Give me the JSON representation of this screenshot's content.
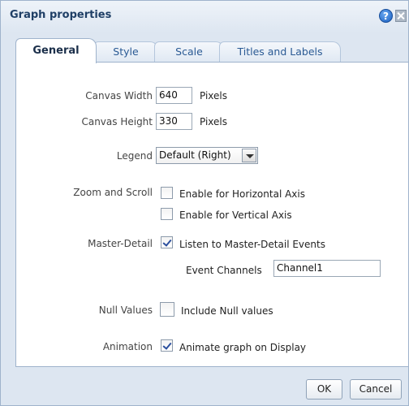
{
  "dialog": {
    "title": "Graph properties"
  },
  "tabs": [
    {
      "label": "General"
    },
    {
      "label": "Style"
    },
    {
      "label": "Scale"
    },
    {
      "label": "Titles and Labels"
    }
  ],
  "general": {
    "canvas_width_label": "Canvas Width",
    "canvas_width_value": "640",
    "canvas_height_label": "Canvas Height",
    "canvas_height_value": "330",
    "pixels_label": "Pixels",
    "legend_label": "Legend",
    "legend_value": "Default (Right)",
    "zoom_label": "Zoom and Scroll",
    "zoom_horizontal": "Enable for Horizontal Axis",
    "zoom_vertical": "Enable for Vertical Axis",
    "master_detail_label": "Master-Detail",
    "master_detail_option": "Listen to Master-Detail Events",
    "event_channels_label": "Event Channels",
    "event_channels_value": "Channel1",
    "null_values_label": "Null Values",
    "null_values_option": "Include Null values",
    "animation_label": "Animation",
    "animation_option": "Animate graph on Display"
  },
  "buttons": {
    "ok": "OK",
    "cancel": "Cancel"
  },
  "colors": {
    "dialog_bg": "#dde6f1",
    "title_text": "#1f3f66",
    "tab_text": "#2a5a94",
    "checkbox_check": "#2b4f9e"
  }
}
